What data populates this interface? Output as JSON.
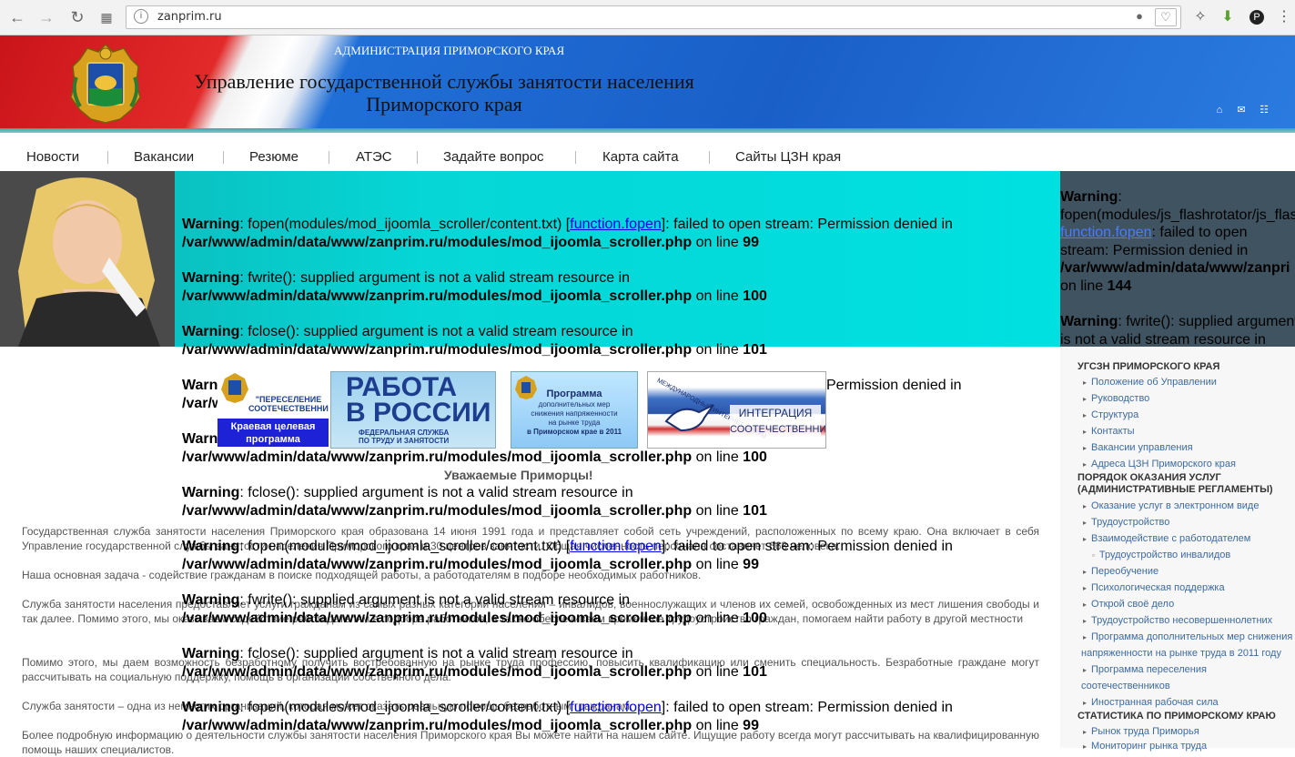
{
  "browser": {
    "url": "zanprim.ru",
    "nav_icons": [
      "back-arrow-icon",
      "forward-arrow-icon",
      "reload-icon",
      "apps-grid-icon"
    ],
    "url_icons": [
      "site-info-icon",
      "lightbulb-icon",
      "heart-icon"
    ],
    "extension_icons": [
      "extension-icon",
      "download-icon",
      "profile-icon",
      "menu-icon"
    ]
  },
  "header": {
    "admin_label": "АДМИНИСТРАЦИЯ ПРИМОРСКОГО КРАЯ",
    "title_line1": "Управление государственной службы занятости населения",
    "title_line2": "Приморского края",
    "icons": [
      "home-icon",
      "mail-icon",
      "sitemap-icon"
    ]
  },
  "nav": {
    "items": [
      "Новости",
      "Вакансии",
      "Резюме",
      "АТЭС",
      "Задайте вопрос",
      "Карта сайта",
      "Сайты ЦЗН края"
    ]
  },
  "warnings": {
    "w1": {
      "label": "Warning",
      "text": ": fopen(modules/mod_ijoomla_scroller/content.txt) [",
      "link": "function.fopen",
      "tail": "]: failed to open stream: Permission denied in",
      "path": "/var/www/admin/data/www/zanprim.ru/modules/mod_ijoomla_scroller.php",
      "online": " on line ",
      "line": "99"
    },
    "w2": {
      "label": "Warning",
      "text": ": fwrite(): supplied argument is not a valid stream resource in",
      "path": "/var/www/admin/data/www/zanprim.ru/modules/mod_ijoomla_scroller.php",
      "online": " on line ",
      "line": "100"
    },
    "w3": {
      "label": "Warning",
      "text": ": fclose(): supplied argument is not a valid stream resource in",
      "path": "/var/www/admin/data/www/zanprim.ru/modules/mod_ijoomla_scroller.php",
      "online": " on line ",
      "line": "101"
    },
    "partial_path": "/var/www/admin/data/www/zanprim.ru/modules/mod_ijoomla_scroller.php",
    "partial_path_short": "/var/w",
    "partial_tail": "Permission denied in",
    "side": {
      "label": "Warning",
      "colon": ":",
      "line1": "fopen(modules/js_flashrotator/js_flash",
      "link": "function.fopen",
      "after_link": ": failed to open",
      "line3": "stream: Permission denied in",
      "path": "/var/www/admin/data/www/zanpri",
      "online": "on line ",
      "line": "144",
      "w2_text": ": fwrite(): supplied argument",
      "w2_line2": "is not a valid stream resource in"
    }
  },
  "banners": {
    "b1": {
      "line1": "\"ПЕРЕСЕЛЕНИЕ",
      "line2": "СООТЕЧЕСТВЕННИКОВ\"",
      "line3": "Краевая целевая",
      "line4": "программа"
    },
    "b2": {
      "line1": "РАБОТА",
      "line2": "В РОССИИ",
      "line3": "ФЕДЕРАЛЬНАЯ СЛУЖБА",
      "line4": "ПО ТРУДУ И ЗАНЯТОСТИ"
    },
    "b3": {
      "line1": "Программа",
      "line2": "дополнительных мер",
      "line3": "снижения напряженности",
      "line4": "на рынке труда",
      "line5": "в Приморском крае в 2011"
    },
    "b4": {
      "arc": "МЕЖДУНАРОДНЫЙ ИНТЕРНЕТ-ФОРУМ",
      "line1": "ИНТЕГРАЦИЯ",
      "line2": "СООТЕЧЕСТВЕННИКОВ"
    }
  },
  "content": {
    "greeting": "Уважаемые Приморцы!",
    "p1": "Государственная служба занятости населения Приморского края образована 14 июня 1991 года и представляет собой сеть учреждений, расположенных по всему краю. Она включает в себя Управление государственной службы занятости населения Приморского края и 30 центров занятости. Общая численность персонала составляет 663 человека.",
    "p2": "Наша основная задача - содействие гражданам в поиске подходящей работы,  а работодателям в подборе необходимых работников.",
    "p3": "Служба занятости населения предоставляет услуги гражданам из самых разных категорий населения – инвалидов, военнослужащих и членов их семей, освобожденных из мест лишения свободы и так далее. Помимо этого, мы оказываем содействие работодателям в подборе работников, а также обеспечиваем временное трудоустройство граждан, помогаем  найти работу в другой местности",
    "p4": "Помимо этого, мы даем возможность безработному получить востребованную на рынке труда профессию, повысить квалификацию или сменить специальность. Безработные граждане могут рассчитывать на социальную поддержку, помощь в организации собственного дела.",
    "p5": "Служба занятости – одна из немногих организаций, которая может оказать реальную помощь безработным гражданам.",
    "p6": "Более подробную информацию о деятельности службы занятости населения Приморского края Вы можете найти на нашем сайте. Ищущие работу всегда могут рассчитывать на квалифицированную помощь наших специалистов."
  },
  "sidebar": {
    "h1": "УГСЗН ПРИМОРСКОГО КРАЯ",
    "items1": [
      "Положение об Управлении",
      "Руководство",
      "Структура",
      "Контакты",
      "Вакансии управления",
      "Адреса ЦЗН Приморского края"
    ],
    "h2_line1": "ПОРЯДОК ОКАЗАНИЯ УСЛУГ",
    "h2_line2": "(АДМИНИСТРАТИВНЫЕ РЕГЛАМЕНТЫ)",
    "items2": [
      "Оказание услуг в электронном виде",
      "Трудоустройство",
      "Взаимодействие с работодателем",
      "Трудоустройство инвалидов",
      "Переобучение",
      "Психологическая поддержка",
      "Открой своё дело",
      "Трудоустройство несовершеннолетних",
      "Программа дополнительных мер снижения",
      "напряженности на рынке труда в 2011 году",
      "Программа переселения",
      "соотечественников",
      "Иностранная рабочая сила"
    ],
    "h3": "СТАТИСТИКА ПО ПРИМОРСКОМУ КРАЮ",
    "items3": [
      "Рынок труда Приморья",
      "Мониторинг рынка труда"
    ]
  }
}
